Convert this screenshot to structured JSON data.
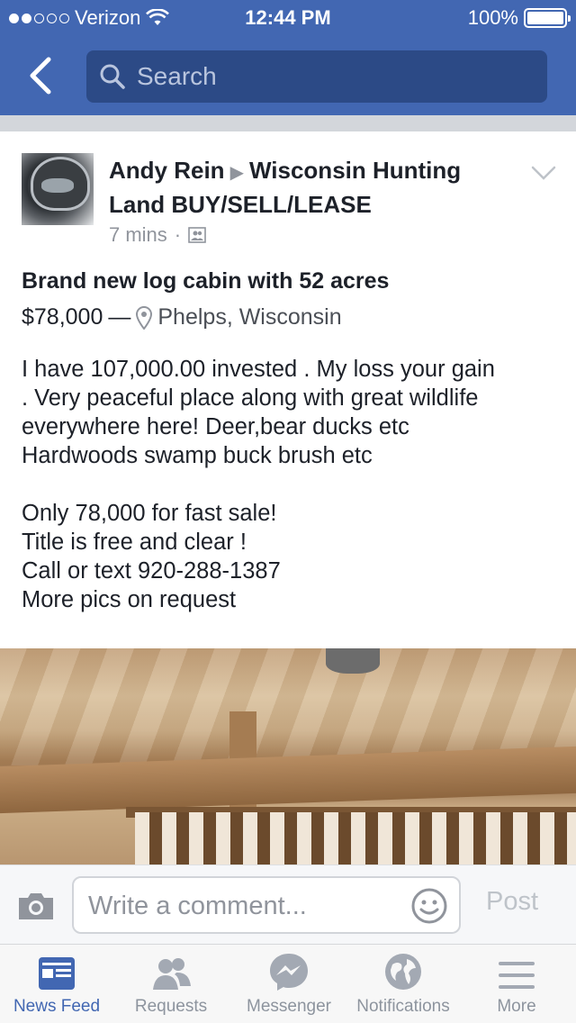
{
  "status_bar": {
    "carrier": "Verizon",
    "time": "12:44 PM",
    "battery": "100%",
    "signal_bars_filled": 2,
    "signal_bars_total": 5
  },
  "nav": {
    "search_placeholder": "Search"
  },
  "post": {
    "author": "Andy Rein",
    "group": "Wisconsin Hunting Land BUY/SELL/LEASE",
    "time_ago": "7 mins",
    "meta_separator": "·",
    "title": "Brand new log cabin with 52 acres",
    "price": "$78,000",
    "price_separator": "—",
    "location": "Phelps, Wisconsin",
    "body_paragraph_1": [
      "I have 107,000.00 invested . My loss your gain",
      ". Very peaceful place along with great wildlife",
      "everywhere here! Deer,bear ducks etc",
      "Hardwoods swamp buck brush etc"
    ],
    "body_paragraph_2": [
      "Only 78,000 for fast sale!",
      "Title is free and clear !",
      "Call or text 920-288-1387",
      "More pics on request"
    ]
  },
  "comment_bar": {
    "placeholder": "Write a comment...",
    "post_label": "Post"
  },
  "tabs": [
    {
      "label": "News Feed",
      "icon": "news-feed-icon",
      "active": true
    },
    {
      "label": "Requests",
      "icon": "requests-icon",
      "active": false
    },
    {
      "label": "Messenger",
      "icon": "messenger-icon",
      "active": false
    },
    {
      "label": "Notifications",
      "icon": "notifications-icon",
      "active": false
    },
    {
      "label": "More",
      "icon": "more-icon",
      "active": false
    }
  ],
  "colors": {
    "brand_blue": "#4267b2",
    "search_bg": "#2c4a86",
    "inactive_gray": "#8d949e"
  }
}
